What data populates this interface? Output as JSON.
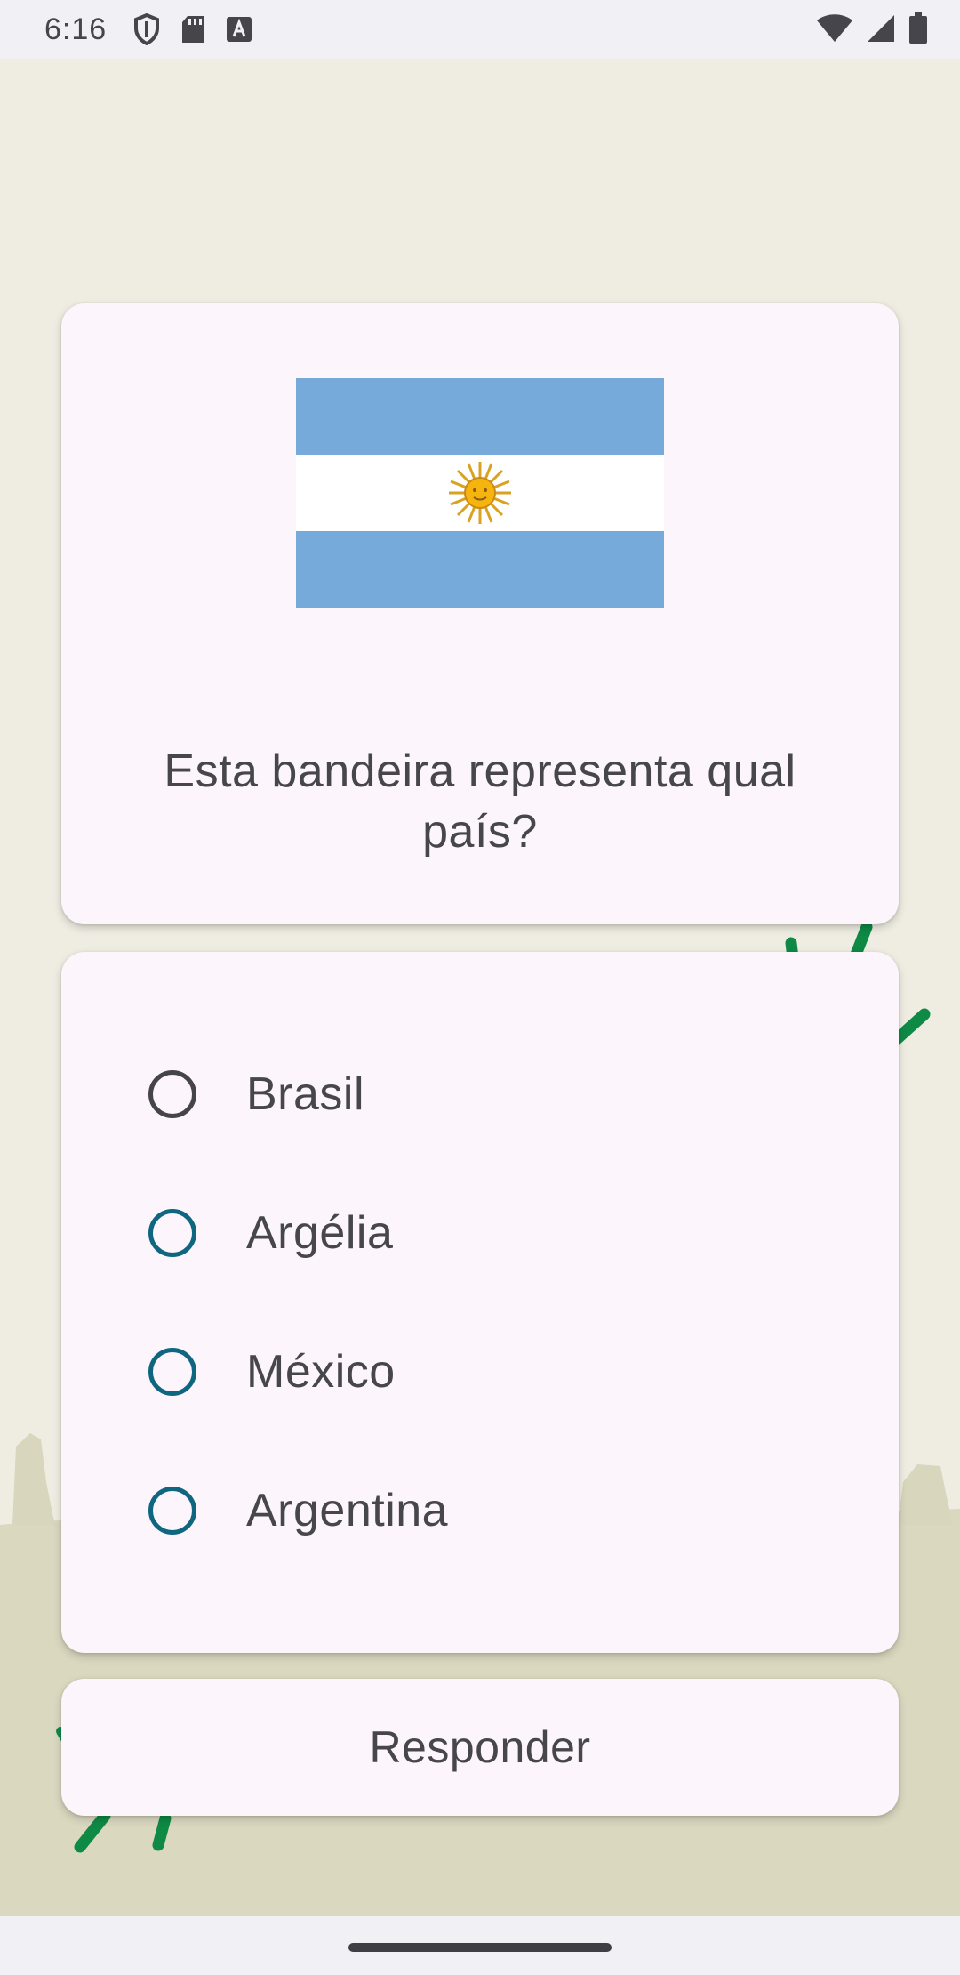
{
  "status_bar": {
    "time": "6:16",
    "left_icons": [
      "shield-icon",
      "sd-card-icon",
      "font-a-icon"
    ],
    "right_icons": [
      "wifi-icon",
      "cellular-signal-icon",
      "battery-icon"
    ]
  },
  "quiz": {
    "flag_country": "Argentina",
    "question": "Esta bandeira representa qual país?",
    "options": [
      {
        "label": "Brasil",
        "selected": false
      },
      {
        "label": "Argélia",
        "selected": false
      },
      {
        "label": "México",
        "selected": false
      },
      {
        "label": "Argentina",
        "selected": false
      }
    ],
    "submit_label": "Responder"
  },
  "colors": {
    "background": "#efede2",
    "card": "#fcf5fb",
    "radio_accent": "#0f6680",
    "flag_blue": "#75aadb",
    "decoration_green": "#0e8a45"
  }
}
